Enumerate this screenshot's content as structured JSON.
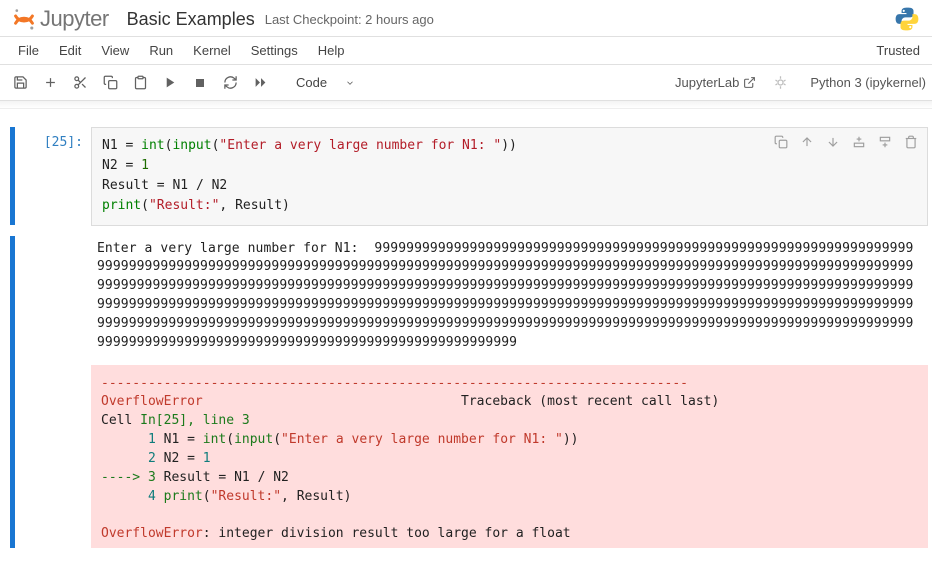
{
  "header": {
    "logo_text": "Jupyter",
    "title": "Basic Examples",
    "checkpoint": "Last Checkpoint: 2 hours ago"
  },
  "menubar": {
    "items": [
      "File",
      "Edit",
      "View",
      "Run",
      "Kernel",
      "Settings",
      "Help"
    ],
    "trusted": "Trusted"
  },
  "toolbar": {
    "celltype": "Code",
    "jupyterlab": "JupyterLab",
    "kernel": "Python 3 (ipykernel)"
  },
  "cell": {
    "prompt": "[25]:",
    "code": {
      "l1_a": "N1 ",
      "l1_b": "= ",
      "l1_c": "int",
      "l1_d": "(",
      "l1_e": "input",
      "l1_f": "(",
      "l1_g": "\"Enter a very large number for N1: \"",
      "l1_h": "))",
      "l2_a": "N2 ",
      "l2_b": "= ",
      "l2_c": "1",
      "l3_a": "Result ",
      "l3_b": "= N1 ",
      "l3_c": "/ ",
      "l3_d": "N2",
      "l4_a": "print",
      "l4_b": "(",
      "l4_c": "\"Result:\"",
      "l4_d": ", Result)"
    },
    "stdout": "Enter a very large number for N1:  99999999999999999999999999999999999999999999999999999999999999999999999999999999999999999999999999999999999999999999999999999999999999999999999999999999999999999999999999999999999999999999999999999999999999999999999999999999999999999999999999999999999999999999999999999999999999999999999999999999999999999999999999999999999999999999999999999999999999999999999999999999999999999999999999999999999999999999999999999999999999999999999999999999999999999999999999999999999999999999999999999999999999999999999999999999999999999999999999999",
    "error": {
      "dashline": "---------------------------------------------------------------------------",
      "name": "OverflowError",
      "traceback": "                                 Traceback (most recent call last)",
      "cell_prefix": "Cell ",
      "cell_in": "In[25]",
      "cell_line": ", line 3",
      "l1_num": "      1",
      "l1_a": " N1 ",
      "l1_b": "=",
      "l1_c": " int",
      "l1_d": "(",
      "l1_e": "input",
      "l1_f": "(",
      "l1_g": "\"Enter a very large number for N1: \"",
      "l1_h": "))",
      "l2_num": "      2",
      "l2_a": " N2 ",
      "l2_b": "=",
      "l2_c": " 1",
      "l3_arrow": "----> ",
      "l3_num": "3",
      "l3_a": " Result ",
      "l3_b": "=",
      "l3_c": " N1 ",
      "l3_d": "/",
      "l3_e": " N2",
      "l4_num": "      4",
      "l4_a": " print",
      "l4_b": "(",
      "l4_c": "\"Result:\"",
      "l4_d": ", Result)",
      "final_name": "OverflowError",
      "final_msg": ": integer division result too large for a float"
    }
  }
}
